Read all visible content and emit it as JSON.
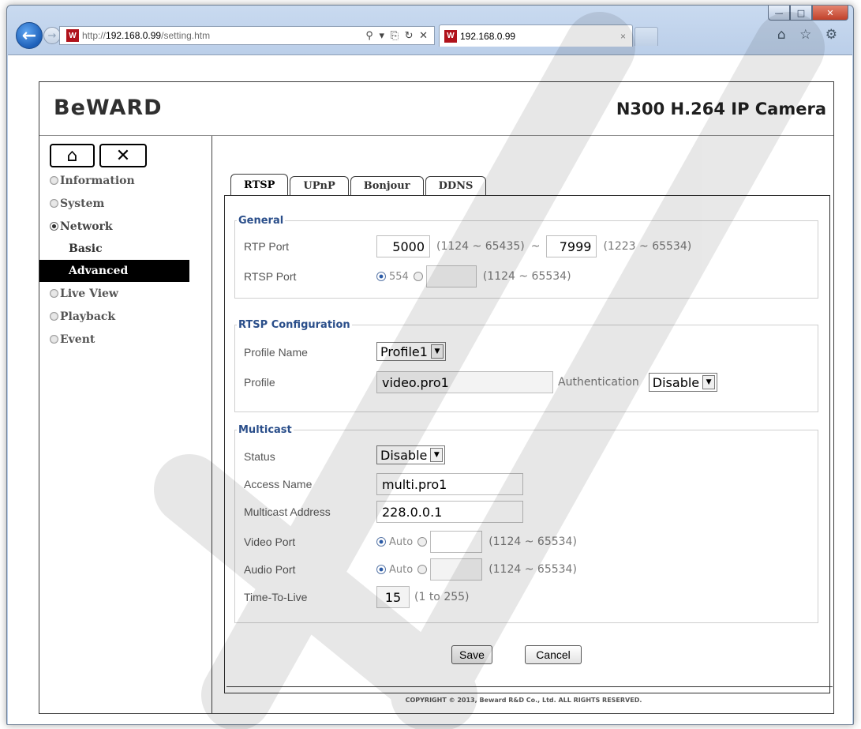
{
  "browser": {
    "url_prefix": "http://",
    "url_host": "192.168.0.99",
    "url_path": "/setting.htm",
    "address_tools": "⚲ ▾ ⎘ ↻ ✕",
    "tab_title": "192.168.0.99",
    "tab_close": "×",
    "toolbar_icons": "⌂ ☆ ⚙",
    "min": "—",
    "max": "□",
    "close": "✕",
    "back": "←",
    "forward": "→",
    "favicon": "W"
  },
  "header": {
    "logo": "BeWARD",
    "product": "N300 H.264 IP Camera"
  },
  "sidebar": {
    "home_icon": "⌂",
    "tools_icon": "✕",
    "items": [
      {
        "label": "Information"
      },
      {
        "label": "System"
      },
      {
        "label": "Network"
      },
      {
        "label": "Live View"
      },
      {
        "label": "Playback"
      },
      {
        "label": "Event"
      }
    ],
    "sub_items": [
      {
        "label": "Basic"
      },
      {
        "label": "Advanced"
      }
    ]
  },
  "tabs": [
    {
      "label": "RTSP"
    },
    {
      "label": "UPnP"
    },
    {
      "label": "Bonjour"
    },
    {
      "label": "DDNS"
    }
  ],
  "general": {
    "legend": "General",
    "rtp_port_label": "RTP Port",
    "rtp_port_from": "5000",
    "rtp_port_from_range": "(1124 ~ 65435)",
    "tilde": "~",
    "rtp_port_to": "7999",
    "rtp_port_to_range": "(1223 ~ 65534)",
    "rtsp_port_label": "RTSP Port",
    "rtsp_port_default": "554",
    "rtsp_port_range": "(1124 ~ 65534)"
  },
  "rtsp_config": {
    "legend": "RTSP Configuration",
    "profile_name_label": "Profile Name",
    "profile_name_value": "Profile1",
    "profile_label": "Profile",
    "profile_value": "video.pro1",
    "auth_label": "Authentication",
    "auth_value": "Disable"
  },
  "multicast": {
    "legend": "Multicast",
    "status_label": "Status",
    "status_value": "Disable",
    "access_name_label": "Access Name",
    "access_name_value": "multi.pro1",
    "address_label": "Multicast Address",
    "address_value": "228.0.0.1",
    "video_port_label": "Video Port",
    "video_port_auto": "Auto",
    "video_port_range": "(1124 ~ 65534)",
    "audio_port_label": "Audio Port",
    "audio_port_auto": "Auto",
    "audio_port_range": "(1124 ~ 65534)",
    "ttl_label": "Time-To-Live",
    "ttl_value": "15",
    "ttl_range": "(1 to 255)"
  },
  "buttons": {
    "save": "Save",
    "cancel": "Cancel"
  },
  "footer": {
    "copyright": "COPYRIGHT © 2013, Beward R&D Co., Ltd. ALL RIGHTS RESERVED."
  },
  "watermark_text": "BEWARD"
}
